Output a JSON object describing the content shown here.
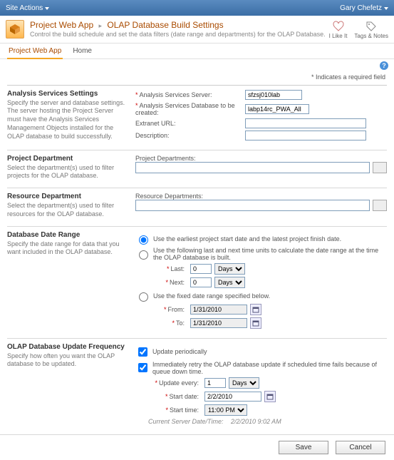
{
  "topbar": {
    "site_actions": "Site Actions",
    "user": "Gary Chefetz"
  },
  "header": {
    "crumb1": "Project Web App",
    "crumb2": "OLAP Database Build Settings",
    "subtitle": "Control the build schedule and set the data filters (date range and departments) for the OLAP Database."
  },
  "ribbon_right": {
    "like": "I Like It",
    "tags": "Tags & Notes"
  },
  "tabs": {
    "t1": "Project Web App",
    "t2": "Home"
  },
  "required_note": "* Indicates a required field",
  "sections": {
    "analysis": {
      "title": "Analysis Services Settings",
      "desc": "Specify the server and database settings. The server hosting the Project Server must have the Analysis Services Management Objects installed for the OLAP database to build successfully.",
      "f_server": "Analysis Services Server:",
      "v_server": "sfzsj010lab",
      "f_db": "Analysis Services Database to be created:",
      "v_db": "labp14rc_PWA_All",
      "f_url": "Extranet URL:",
      "f_desc": "Description:"
    },
    "projdept": {
      "title": "Project Department",
      "desc": "Select the department(s) used to filter projects for the OLAP database.",
      "label": "Project Departments:"
    },
    "resdept": {
      "title": "Resource Department",
      "desc": "Select the department(s) used to filter resources for the OLAP database.",
      "label": "Resource Departments:"
    },
    "daterange": {
      "title": "Database Date Range",
      "desc": "Specify the date range for data that you want included in the OLAP database.",
      "opt1": "Use the earliest project start date and the latest project finish date.",
      "opt2": "Use the following last and next time units to calculate the date range at the time the OLAP database is built.",
      "last": "Last:",
      "next": "Next:",
      "last_v": "0",
      "next_v": "0",
      "unit": "Days",
      "opt3": "Use the fixed date range specified below.",
      "from": "From:",
      "to": "To:",
      "from_v": "1/31/2010",
      "to_v": "1/31/2010"
    },
    "update": {
      "title": "OLAP Database Update Frequency",
      "desc": "Specify how often you want the OLAP database to be updated.",
      "chk1": "Update periodically",
      "chk2": "Immediately retry the OLAP database update if scheduled time fails because of queue down time.",
      "every": "Update every:",
      "every_v": "1",
      "every_unit": "Days",
      "startdate": "Start date:",
      "startdate_v": "2/2/2010",
      "starttime": "Start time:",
      "starttime_v": "11:00 PM",
      "servertime_lbl": "Current Server Date/Time:",
      "servertime_v": "2/2/2010 9:02 AM"
    }
  },
  "buttons": {
    "save": "Save",
    "cancel": "Cancel"
  }
}
